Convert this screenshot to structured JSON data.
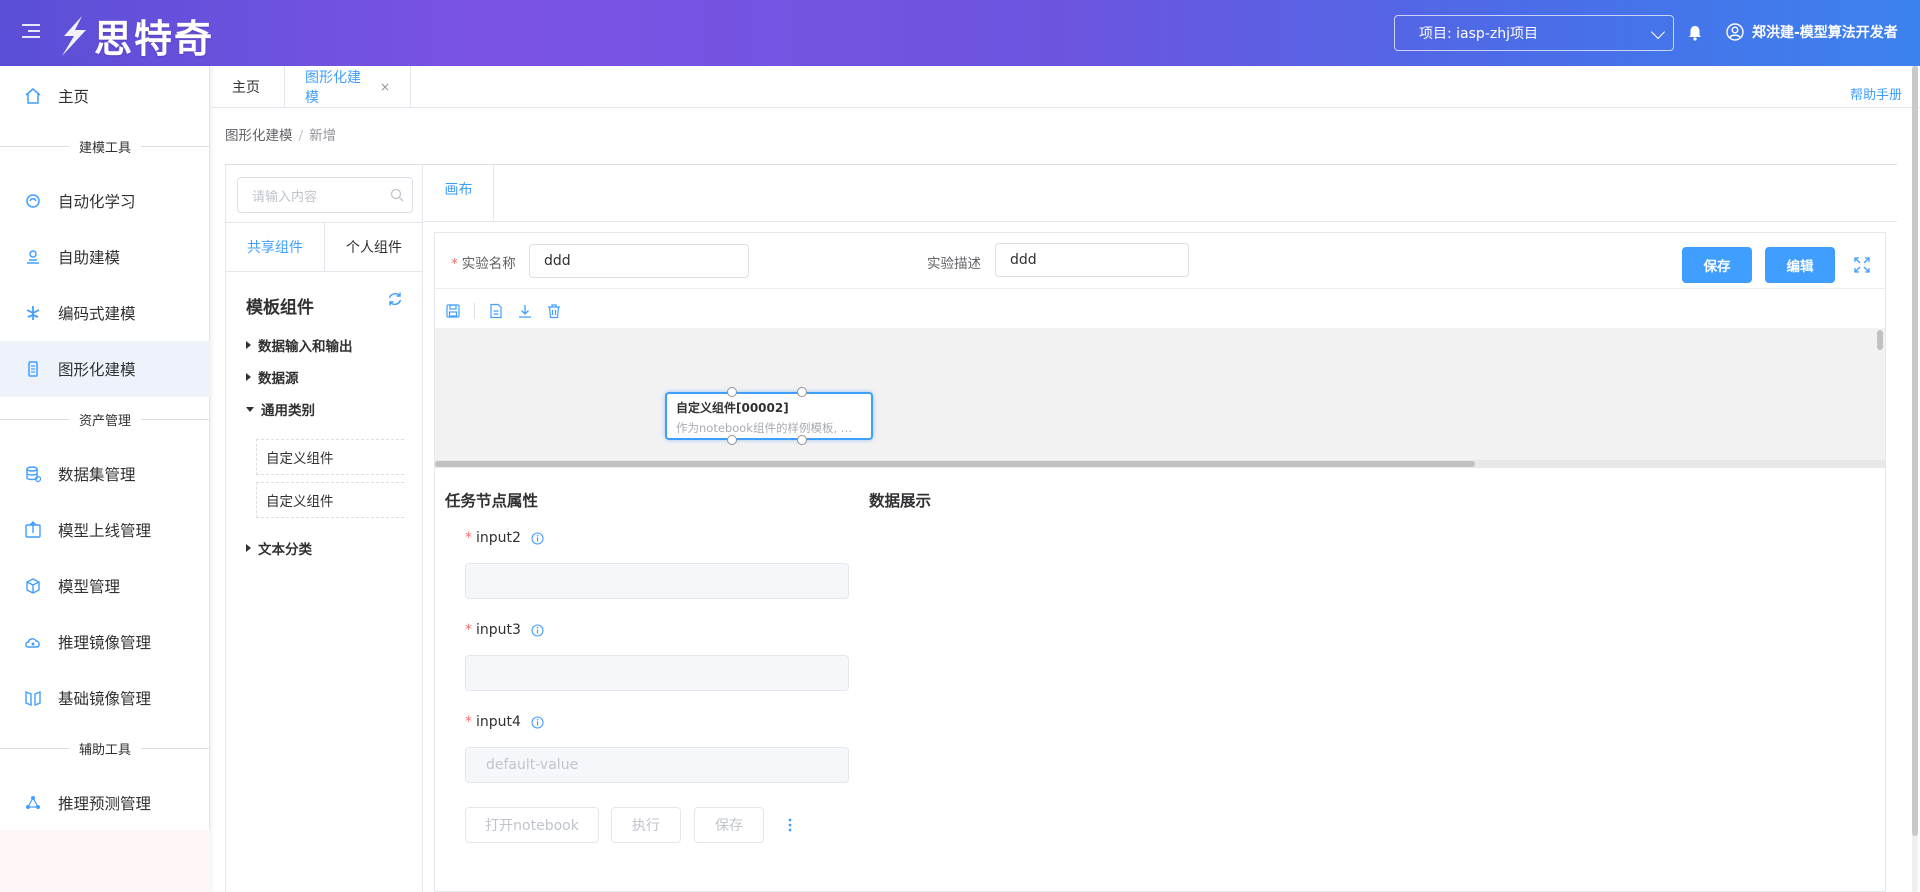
{
  "header": {
    "logo_text": "思特奇",
    "project_label": "项目: iasp-zhj项目",
    "user_name": "郑洪建-模型算法开发者"
  },
  "sidebar": {
    "home": "主页",
    "sections": {
      "modeling": "建模工具",
      "assets": "资产管理",
      "aux": "辅助工具"
    },
    "items": [
      {
        "label": "自动化学习",
        "icon": "automl-icon"
      },
      {
        "label": "自助建模",
        "icon": "self-modeling-icon"
      },
      {
        "label": "编码式建模",
        "icon": "code-modeling-icon"
      },
      {
        "label": "图形化建模",
        "icon": "graphic-modeling-icon"
      },
      {
        "label": "数据集管理",
        "icon": "database-icon"
      },
      {
        "label": "模型上线管理",
        "icon": "upload-icon"
      },
      {
        "label": "模型管理",
        "icon": "cube-icon"
      },
      {
        "label": "推理镜像管理",
        "icon": "cloud-icon"
      },
      {
        "label": "基础镜像管理",
        "icon": "book-icon"
      },
      {
        "label": "推理预测管理",
        "icon": "network-icon"
      }
    ]
  },
  "tabs": {
    "home": "主页",
    "graphic": "图形化建模",
    "close": "×",
    "help": "帮助手册"
  },
  "breadcrumb": {
    "parent": "图形化建模",
    "sep": "/",
    "current": "新增"
  },
  "left_panel": {
    "search_placeholder": "请输入内容",
    "shared_tab": "共享组件",
    "personal_tab": "个人组件",
    "template_title": "模板组件",
    "tree": {
      "io": "数据输入和输出",
      "source": "数据源",
      "general": "通用类别",
      "leaf1": "自定义组件",
      "leaf2": "自定义组件",
      "text": "文本分类"
    }
  },
  "canvas": {
    "tab": "画布",
    "exp_name_label": "实验名称",
    "exp_name_value": "ddd",
    "exp_desc_label": "实验描述",
    "exp_desc_value": "ddd",
    "save": "保存",
    "edit": "编辑",
    "node": {
      "title": "自定义组件[00002]",
      "desc": "作为notebook组件的样例模板, 开发者可参考"
    }
  },
  "properties": {
    "title": "任务节点属性",
    "data_title": "数据展示",
    "fields": [
      {
        "label": "input2",
        "value": ""
      },
      {
        "label": "input3",
        "value": ""
      },
      {
        "label": "input4",
        "value": "default-value"
      }
    ],
    "btn_notebook": "打开notebook",
    "btn_run": "执行",
    "btn_save": "保存"
  }
}
